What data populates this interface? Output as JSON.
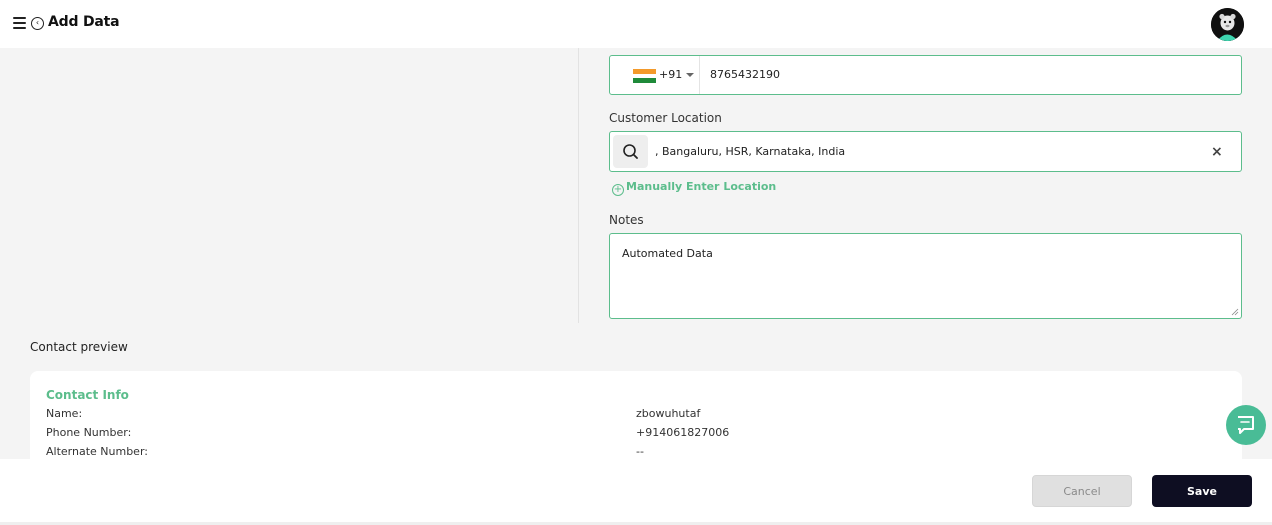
{
  "header": {
    "title": "Add Data",
    "menu_icon": "hamburger-menu-icon",
    "back_icon": "back-circle-icon"
  },
  "form": {
    "phone": {
      "country_flag": "india-flag",
      "dial_code": "+91",
      "value": "8765432190"
    },
    "location": {
      "label": "Customer Location",
      "value": ", Bangaluru, HSR, Karnataka, India",
      "clear_symbol": "×"
    },
    "manual_location_link": "Manually Enter Location",
    "notes": {
      "label": "Notes",
      "value": "Automated Data"
    }
  },
  "preview": {
    "heading": "Contact preview",
    "section_title": "Contact Info",
    "rows": [
      {
        "label": "Name:",
        "value": "zbowuhutaf"
      },
      {
        "label": "Phone Number:",
        "value": "+914061827006"
      },
      {
        "label": "Alternate Number:",
        "value": "--"
      }
    ]
  },
  "footer": {
    "cancel_label": "Cancel",
    "save_label": "Save"
  },
  "colors": {
    "accent": "#5cbd8c",
    "primary_button": "#0e0e22",
    "background": "#f4f4f4",
    "fab": "#49bc96"
  }
}
